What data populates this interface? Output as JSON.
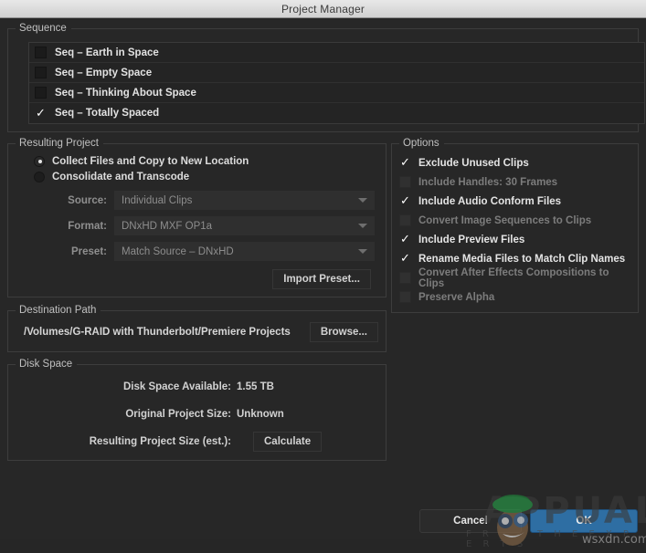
{
  "window": {
    "title": "Project Manager"
  },
  "sequence": {
    "group_title": "Sequence",
    "items": [
      {
        "label": "Seq – Earth in Space",
        "checked": false
      },
      {
        "label": "Seq – Empty Space",
        "checked": false
      },
      {
        "label": "Seq – Thinking About Space",
        "checked": false
      },
      {
        "label": "Seq – Totally Spaced",
        "checked": true
      }
    ]
  },
  "resulting_project": {
    "group_title": "Resulting Project",
    "radios": [
      {
        "label": "Collect Files and Copy to New Location",
        "selected": true
      },
      {
        "label": "Consolidate and Transcode",
        "selected": false
      }
    ],
    "fields": [
      {
        "label": "Source:",
        "value": "Individual Clips"
      },
      {
        "label": "Format:",
        "value": "DNxHD MXF OP1a"
      },
      {
        "label": "Preset:",
        "value": "Match Source – DNxHD"
      }
    ],
    "import_preset_label": "Import Preset..."
  },
  "options": {
    "group_title": "Options",
    "items": [
      {
        "label": "Exclude Unused Clips",
        "checked": true,
        "enabled": true
      },
      {
        "label": "Include Handles:  30 Frames",
        "checked": false,
        "enabled": false
      },
      {
        "label": "Include Audio Conform Files",
        "checked": true,
        "enabled": true
      },
      {
        "label": "Convert Image Sequences to Clips",
        "checked": false,
        "enabled": false
      },
      {
        "label": "Include Preview Files",
        "checked": true,
        "enabled": true
      },
      {
        "label": "Rename Media Files to Match Clip Names",
        "checked": true,
        "enabled": true
      },
      {
        "label": "Convert After Effects Compositions to Clips",
        "checked": false,
        "enabled": false
      },
      {
        "label": "Preserve Alpha",
        "checked": false,
        "enabled": false
      }
    ]
  },
  "destination_path": {
    "group_title": "Destination Path",
    "path": "/Volumes/G-RAID with Thunderbolt/Premiere Projects",
    "browse_label": "Browse..."
  },
  "disk_space": {
    "group_title": "Disk Space",
    "rows": [
      {
        "label": "Disk Space Available:",
        "value": "1.55 TB"
      },
      {
        "label": "Original Project Size:",
        "value": "Unknown"
      }
    ],
    "resulting_label": "Resulting Project Size (est.):",
    "calculate_label": "Calculate"
  },
  "footer": {
    "cancel_label": "Cancel",
    "ok_label": "OK"
  },
  "watermark": {
    "brand": "APPUALS",
    "tagline": "F R O M   T H E   E X P E R T S",
    "url": "wsxdn.com"
  },
  "colors": {
    "dialog_bg": "#272727",
    "titlebar_bg": "#e0e0e0",
    "accent_ok": "#2e6ea3",
    "text_primary": "#e2e2e2",
    "text_muted": "#8f8f8f",
    "text_disabled": "#7c7c7c",
    "group_border": "#3d3d3d"
  }
}
